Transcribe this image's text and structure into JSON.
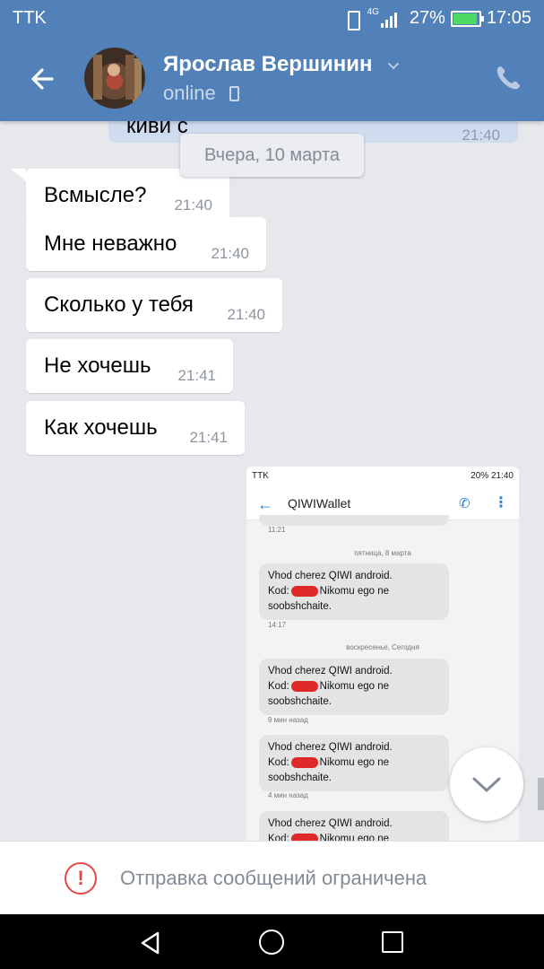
{
  "status_bar": {
    "carrier": "TTK",
    "network": "4G",
    "battery": "27%",
    "time": "17:05"
  },
  "header": {
    "contact_name": "Ярослав Вершинин",
    "status": "online"
  },
  "chat": {
    "previous_message": {
      "text": "киви с",
      "time": "21:40"
    },
    "date_separator": "Вчера, 10 марта",
    "messages": [
      {
        "text": "Всмысле?",
        "time": "21:40"
      },
      {
        "text": "Мне неважно",
        "time": "21:40"
      },
      {
        "text": "Сколько у тебя",
        "time": "21:40"
      },
      {
        "text": "Не хочешь",
        "time": "21:41"
      },
      {
        "text": "Как хочешь",
        "time": "21:41"
      }
    ],
    "attached_screenshot": {
      "status_left": "TTK",
      "status_right": "20% 21:40",
      "title": "QIWIWallet",
      "top_time": "11:21",
      "day1": "пятница, 8 марта",
      "day2": "воскресенье, Сегодня",
      "sms": [
        {
          "line1": "Vhod cherez QIWI android.",
          "line2a": "Kod:",
          "line2b": "Nikomu ego ne",
          "line3": "soobshchaite.",
          "time": "14:17"
        },
        {
          "line1": "Vhod cherez QIWI android.",
          "line2a": "Kod:",
          "line2b": "Nikomu ego ne",
          "line3": "soobshchaite.",
          "time": "9 мин назад"
        },
        {
          "line1": "Vhod cherez QIWI android.",
          "line2a": "Kod:",
          "line2b": "Nikomu ego ne",
          "line3": "soobshchaite.",
          "time": "4 мин назад"
        },
        {
          "line1": "Vhod cherez QIWI android.",
          "line2a": "Kod:",
          "line2b": "Nikomu ego ne",
          "line3": "",
          "time": ""
        }
      ]
    }
  },
  "composer": {
    "restriction_text": "Отправка сообщений ограничена"
  },
  "colors": {
    "header_bg": "#5181b8",
    "chat_bg": "#e6e8ec",
    "warning": "#e64646"
  },
  "icons": [
    "back-arrow-icon",
    "chevron-down-icon",
    "phone-icon",
    "mobile-icon",
    "warning-icon",
    "scroll-down-icon",
    "nav-back-icon",
    "nav-home-icon",
    "nav-recent-icon"
  ]
}
